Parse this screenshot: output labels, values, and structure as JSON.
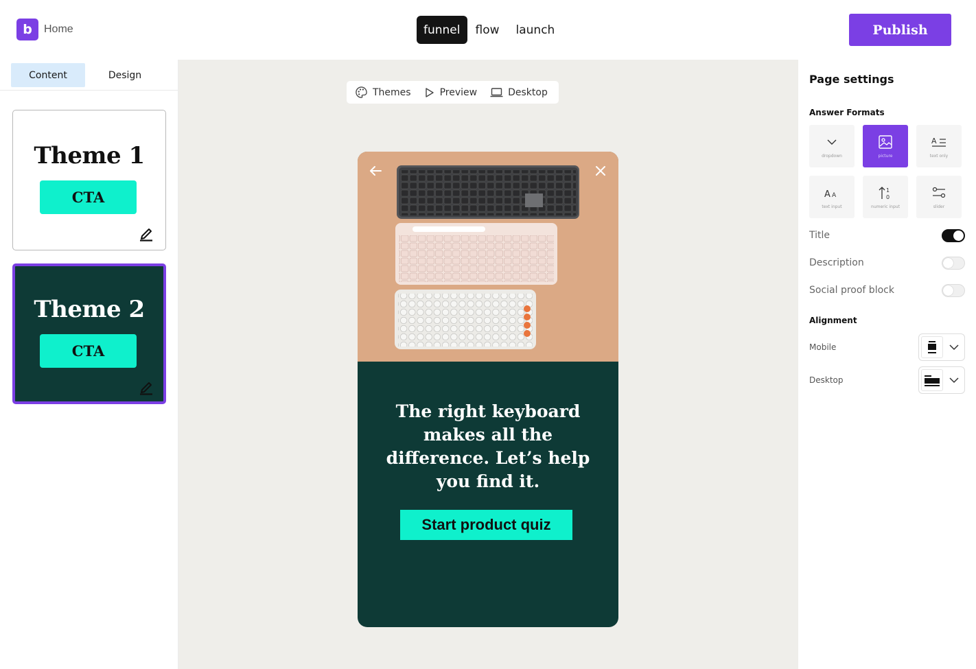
{
  "header": {
    "logo_letter": "b",
    "home_label": "Home",
    "modes": [
      "funnel",
      "flow",
      "launch"
    ],
    "active_mode": "funnel",
    "publish_label": "Publish"
  },
  "left_panel": {
    "tabs": [
      "Content",
      "Design"
    ],
    "active_tab": "Content",
    "themes": [
      {
        "title": "Theme 1",
        "cta": "CTA",
        "selected": false
      },
      {
        "title": "Theme 2",
        "cta": "CTA",
        "selected": true
      }
    ]
  },
  "canvas": {
    "toolbar": [
      {
        "label": "Themes",
        "icon": "palette-icon"
      },
      {
        "label": "Preview",
        "icon": "play-icon"
      },
      {
        "label": "Desktop",
        "icon": "laptop-icon"
      }
    ],
    "preview": {
      "headline": "The right keyboard makes all the difference. Let’s help you find it.",
      "cta": "Start product quiz"
    }
  },
  "right_panel": {
    "title": "Page settings",
    "answer_formats_label": "Answer Formats",
    "formats": [
      {
        "label": "dropdown",
        "icon": "chevron-down-icon",
        "active": false
      },
      {
        "label": "picture",
        "icon": "image-icon",
        "active": true
      },
      {
        "label": "text only",
        "icon": "text-lines-icon",
        "active": false
      },
      {
        "label": "text input",
        "icon": "text-size-icon",
        "active": false
      },
      {
        "label": "numeric input",
        "icon": "sort-numeric-icon",
        "active": false
      },
      {
        "label": "slider",
        "icon": "sliders-icon",
        "active": false
      }
    ],
    "toggles": [
      {
        "label": "Title",
        "on": true
      },
      {
        "label": "Description",
        "on": false
      },
      {
        "label": "Social proof block",
        "on": false
      }
    ],
    "alignment_label": "Alignment",
    "alignment": [
      {
        "label": "Mobile"
      },
      {
        "label": "Desktop"
      }
    ]
  },
  "colors": {
    "brand": "#7b3fe4",
    "cta": "#0ff0cc",
    "dark_green": "#0e3a36",
    "canvas_bg": "#efeeea"
  }
}
